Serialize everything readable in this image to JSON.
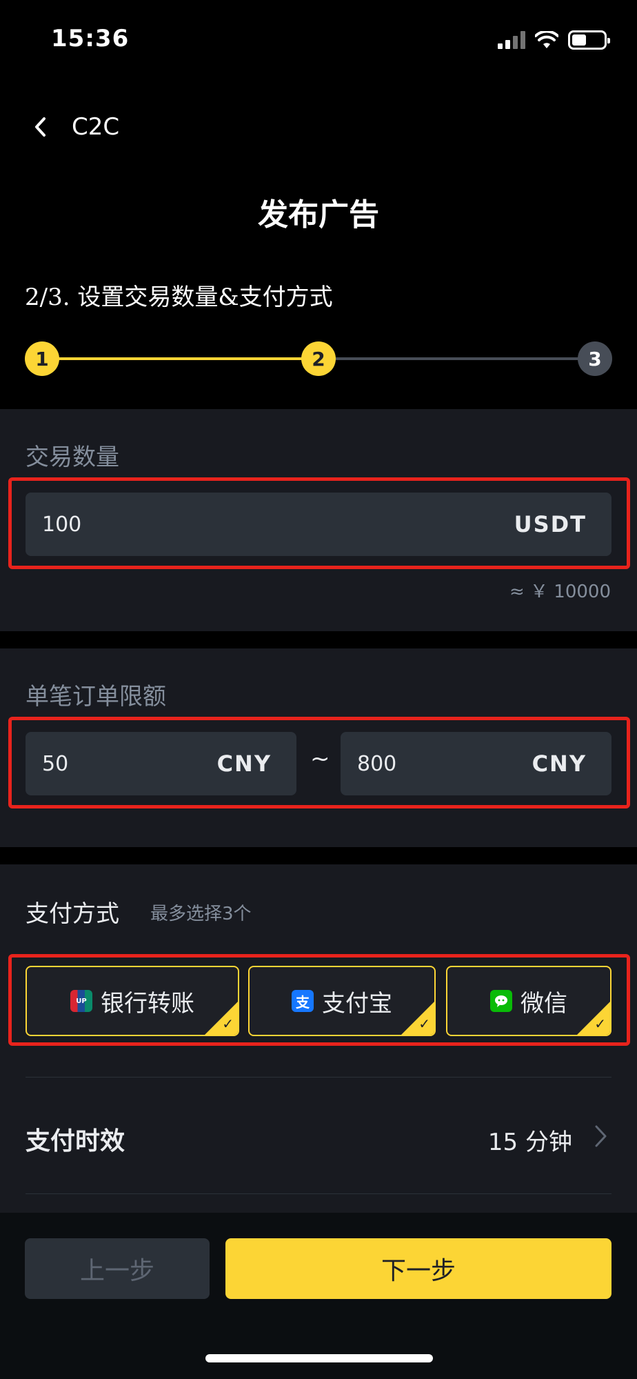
{
  "status_bar": {
    "time": "15:36"
  },
  "nav": {
    "back_label": "C2C"
  },
  "page": {
    "title": "发布广告",
    "step_text": "2/3. 设置交易数量&支付方式"
  },
  "stepper": {
    "steps": [
      "1",
      "2",
      "3"
    ],
    "current": 2
  },
  "quantity": {
    "label": "交易数量",
    "value": "100",
    "unit": "USDT",
    "approx": "≈ ￥ 10000"
  },
  "limit": {
    "label": "单笔订单限额",
    "min_value": "50",
    "min_unit": "CNY",
    "separator": "~",
    "max_value": "800",
    "max_unit": "CNY"
  },
  "payment": {
    "title": "支付方式",
    "subtitle": "最多选择3个",
    "methods": [
      {
        "label": "银行转账",
        "icon": "unionpay-icon",
        "selected": true
      },
      {
        "label": "支付宝",
        "icon": "alipay-icon",
        "selected": true
      },
      {
        "label": "微信",
        "icon": "wechat-icon",
        "selected": true
      }
    ]
  },
  "payment_time": {
    "label": "支付时效",
    "value": "15 分钟"
  },
  "footer": {
    "prev_label": "上一步",
    "next_label": "下一步"
  },
  "colors": {
    "accent": "#fcd535",
    "background": "#000000",
    "panel": "#181a20",
    "highlight_box": "#e8231c"
  }
}
